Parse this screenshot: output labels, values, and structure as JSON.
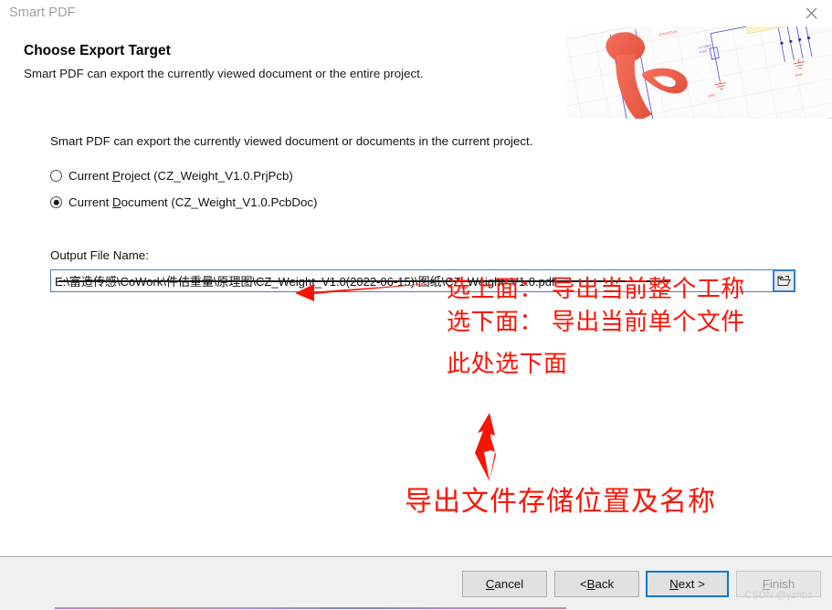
{
  "window": {
    "title": "Smart PDF",
    "close_icon": "close-icon"
  },
  "header": {
    "title": "Choose Export Target",
    "subtitle": "Smart PDF can export the currently viewed document or the entire project.",
    "art_icon": "pdf-acrobat-logo-schematic-banner"
  },
  "body": {
    "intro": "Smart PDF can export the currently viewed document or documents in the current project.",
    "radio_group": {
      "name": "export-target",
      "options": [
        {
          "id": "current-project",
          "label_prefix": "Current ",
          "label_accel": "P",
          "label_suffix": "roject (CZ_Weight_V1.0.PrjPcb)",
          "selected": false
        },
        {
          "id": "current-document",
          "label_prefix": "Current ",
          "label_accel": "D",
          "label_suffix": "ocument (CZ_Weight_V1.0.PcbDoc)",
          "selected": true
        }
      ]
    },
    "output": {
      "label": "Output File Name:",
      "value": "E:\\富造传感\\CoWork\\件估重量\\原理图\\CZ_Weight_V1.0(2022-06-15)\\图纸\\CZ_Weight_V1.0.pdf",
      "placeholder": "Output File Name",
      "browse_icon": "folder-open-icon"
    }
  },
  "annotations": {
    "line1": "选上面： 导出当前整个工称",
    "line2": "选下面： 导出当前单个文件",
    "line3": "此处选下面",
    "bottom": "导出文件存储位置及名称",
    "arrow_radio_icon": "left-arrow-annotation",
    "arrow_path_icon": "up-arrow-annotation",
    "color": "#fb1406"
  },
  "footer": {
    "buttons": [
      {
        "id": "cancel",
        "prefix": "",
        "accel": "C",
        "suffix": "ancel",
        "state": "enabled"
      },
      {
        "id": "back",
        "prefix": "< ",
        "accel": "B",
        "suffix": "ack",
        "state": "enabled"
      },
      {
        "id": "next",
        "prefix": "",
        "accel": "N",
        "suffix": "ext >",
        "state": "focused"
      },
      {
        "id": "finish",
        "prefix": "",
        "accel": "F",
        "suffix": "inish",
        "state": "disabled"
      }
    ],
    "watermark": "CSDN @yzhbz"
  },
  "colors": {
    "accent_focus": "#0078d7",
    "annotation_red": "#fb1406",
    "footer_bg": "#f0f0f0",
    "input_border": "#4d7ebf"
  }
}
